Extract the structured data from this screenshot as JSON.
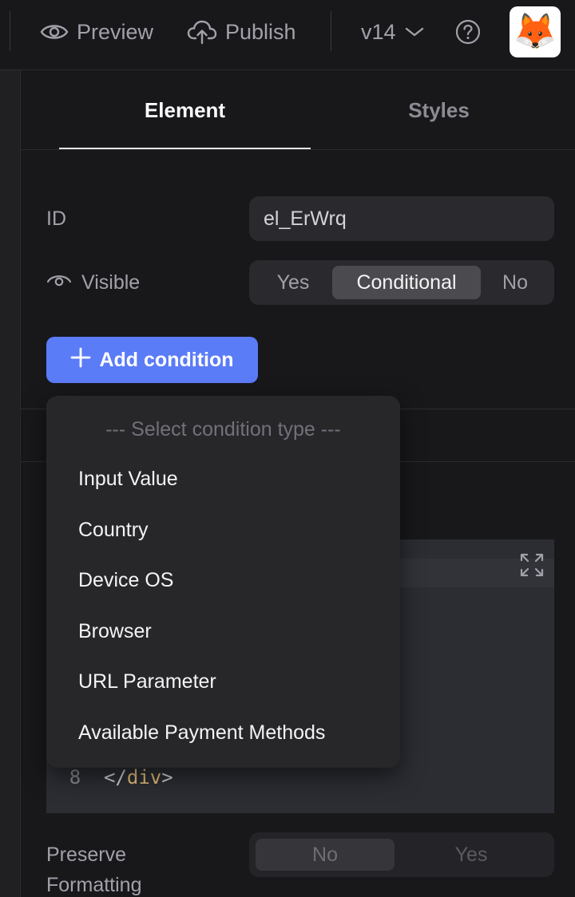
{
  "topbar": {
    "preview_label": "Preview",
    "publish_label": "Publish",
    "version_label": "v14",
    "avatar_emoji": "🦊"
  },
  "tabs": {
    "element_label": "Element",
    "styles_label": "Styles"
  },
  "fields": {
    "id_label": "ID",
    "id_value": "el_ErWrq",
    "visible_label": "Visible",
    "visible_options": [
      "Yes",
      "Conditional",
      "No"
    ],
    "visible_selected": "Conditional"
  },
  "add_condition_label": "Add condition",
  "dropdown": {
    "header": "--- Select condition type ---",
    "items": [
      "Input Value",
      "Country",
      "Device OS",
      "Browser",
      "URL Parameter",
      "Available Payment Methods"
    ]
  },
  "code": {
    "line_number": "8",
    "line_text_prefix": "</",
    "line_tag": "div",
    "line_text_suffix": ">"
  },
  "preserve_formatting": {
    "label": "Preserve Formatting",
    "options": [
      "No",
      "Yes"
    ],
    "selected": "No"
  },
  "colors": {
    "accent": "#5b7cf7",
    "background": "#18181b",
    "panel": "#2a2a2e",
    "dropdown": "#27272a"
  }
}
